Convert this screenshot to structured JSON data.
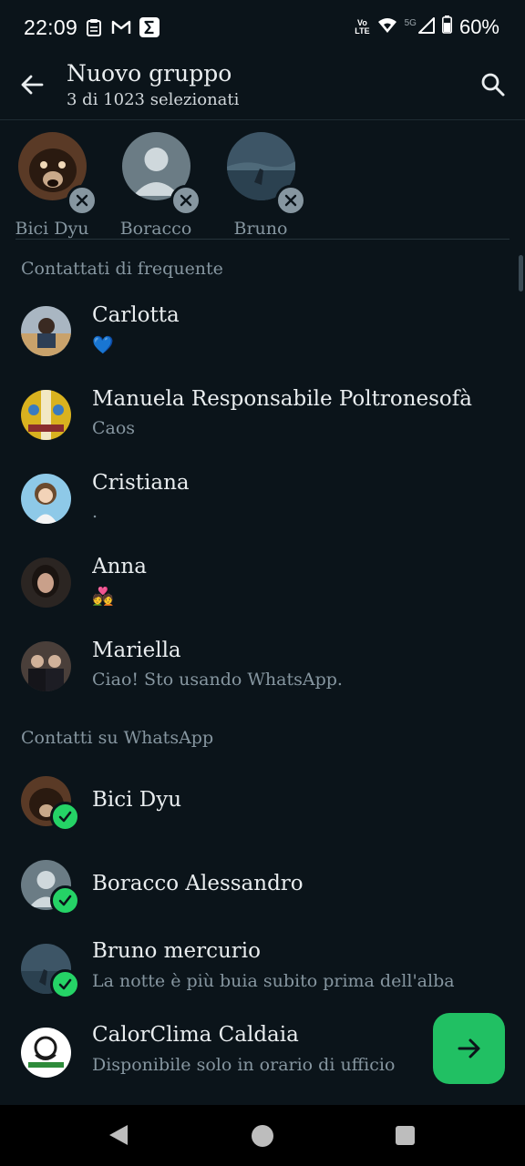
{
  "status_bar": {
    "time": "22:09",
    "notification_icons": [
      "clipboard-icon",
      "gmail-icon",
      "sigma-app-icon"
    ],
    "volte_top": "Vo",
    "volte_bottom": "LTE",
    "network": "5G",
    "battery": "60%"
  },
  "app_bar": {
    "title": "Nuovo gruppo",
    "subtitle": "3 di 1023 selezionati"
  },
  "selected": [
    {
      "name": "Bici Dyu",
      "avatar": "dog-photo"
    },
    {
      "name": "Boracco",
      "avatar": "default-person"
    },
    {
      "name": "Bruno",
      "avatar": "sea-photo"
    }
  ],
  "sections": {
    "frequent": "Contattati di frequente",
    "whatsapp": "Contatti su WhatsApp"
  },
  "frequent_contacts": [
    {
      "name": "Carlotta",
      "status": "💙"
    },
    {
      "name": "Manuela Responsabile Poltronesofà",
      "status": "Caos"
    },
    {
      "name": "Cristiana",
      "status": "."
    },
    {
      "name": "Anna",
      "status": "💑"
    },
    {
      "name": "Mariella",
      "status": "Ciao! Sto usando WhatsApp."
    }
  ],
  "whatsapp_contacts": [
    {
      "name": "Bici Dyu",
      "status": "",
      "selected": true
    },
    {
      "name": "Boracco Alessandro",
      "status": "",
      "selected": true
    },
    {
      "name": "Bruno mercurio",
      "status": "La notte è più buia subito prima dell'alba",
      "selected": true
    },
    {
      "name": "CalorClima Caldaia",
      "status": "Disponibile solo in orario di ufficio",
      "selected": false
    }
  ],
  "fab_icon": "arrow-right-icon",
  "colors": {
    "background": "#0b141a",
    "accent": "#25d366",
    "secondary_text": "#8696a0"
  }
}
